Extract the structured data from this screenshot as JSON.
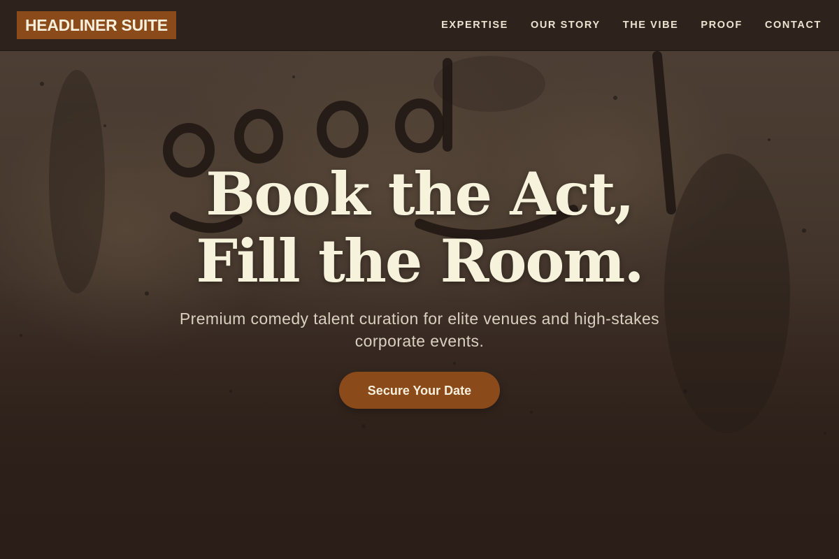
{
  "navbar": {
    "logo": "HEADLINER SUITE",
    "links": [
      "EXPERTISE",
      "OUR STORY",
      "THE VIBE",
      "PROOF",
      "CONTACT"
    ]
  },
  "hero": {
    "title_line1": "Book the Act,",
    "title_line2": "Fill the Room.",
    "subtitle": "Premium comedy talent curation for elite venues and high-stakes corporate events.",
    "cta_label": "Secure Your Date"
  },
  "colors": {
    "accent": "#8b4a1a",
    "nav_bg": "#2d211b",
    "title_text": "#f6f2dc",
    "subtitle_text": "#d9d0c0"
  }
}
